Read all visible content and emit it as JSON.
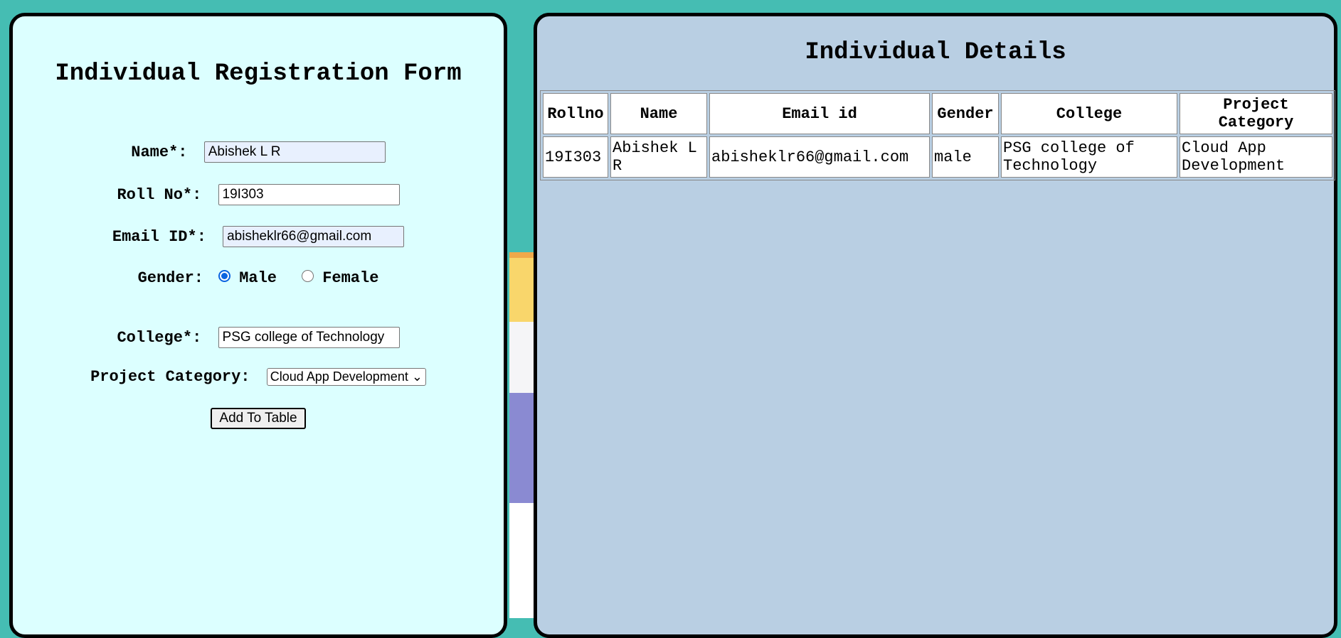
{
  "form": {
    "title": "Individual Registration Form",
    "name_label": "Name*:",
    "name_value": "Abishek L R",
    "roll_label": "Roll No*:",
    "roll_value": "19I303",
    "email_label": "Email ID*:",
    "email_value": "abisheklr66@gmail.com",
    "gender_label": "Gender:",
    "gender_options": [
      "Male",
      "Female"
    ],
    "gender_selected": "Male",
    "college_label": "College*:",
    "college_value": "PSG college of Technology",
    "category_label": "Project Category:",
    "category_selected": "Cloud App Development",
    "submit_label": "Add To Table"
  },
  "details": {
    "title": "Individual Details",
    "columns": [
      "Rollno",
      "Name",
      "Email id",
      "Gender",
      "College",
      "Project Category"
    ],
    "rows": [
      [
        "19I303",
        "Abishek L R",
        "abisheklr66@gmail.com",
        "male",
        "PSG college of Technology",
        "Cloud App Development"
      ]
    ]
  },
  "colors": {
    "page_background": "#45bdb3",
    "form_panel": "#dcffff",
    "details_panel": "#b9cfe3",
    "radio_accent": "#0b64e0"
  }
}
